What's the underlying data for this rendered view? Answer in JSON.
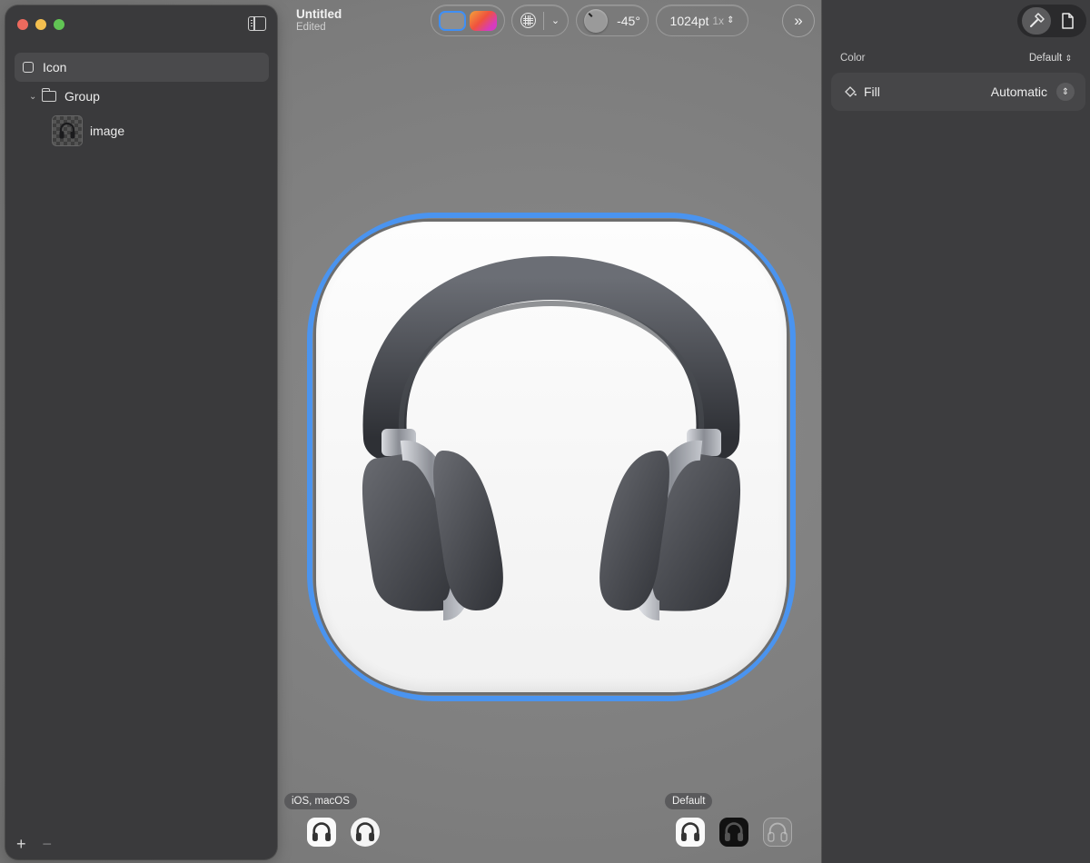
{
  "document": {
    "title": "Untitled",
    "status": "Edited"
  },
  "sidebar": {
    "items": [
      {
        "label": "Icon",
        "icon": "rounded-square-icon",
        "selected": true
      },
      {
        "label": "Group",
        "icon": "folder-icon",
        "expanded": true
      },
      {
        "label": "image",
        "icon": "image-thumbnail"
      }
    ],
    "footer": {
      "add_label": "+",
      "remove_label": "−"
    }
  },
  "toolbar": {
    "angle": "-45°",
    "size": "1024pt",
    "scale": "1x"
  },
  "inspector": {
    "section_label": "Color",
    "section_value": "Default",
    "fill_label": "Fill",
    "fill_value": "Automatic"
  },
  "previews": {
    "platform_chip": "iOS, macOS",
    "appearance_chip": "Default"
  },
  "colors": {
    "accent": "#4a94f0",
    "sidebar_bg": "#3a3a3c",
    "inspector_bg": "#3d3d3f"
  }
}
